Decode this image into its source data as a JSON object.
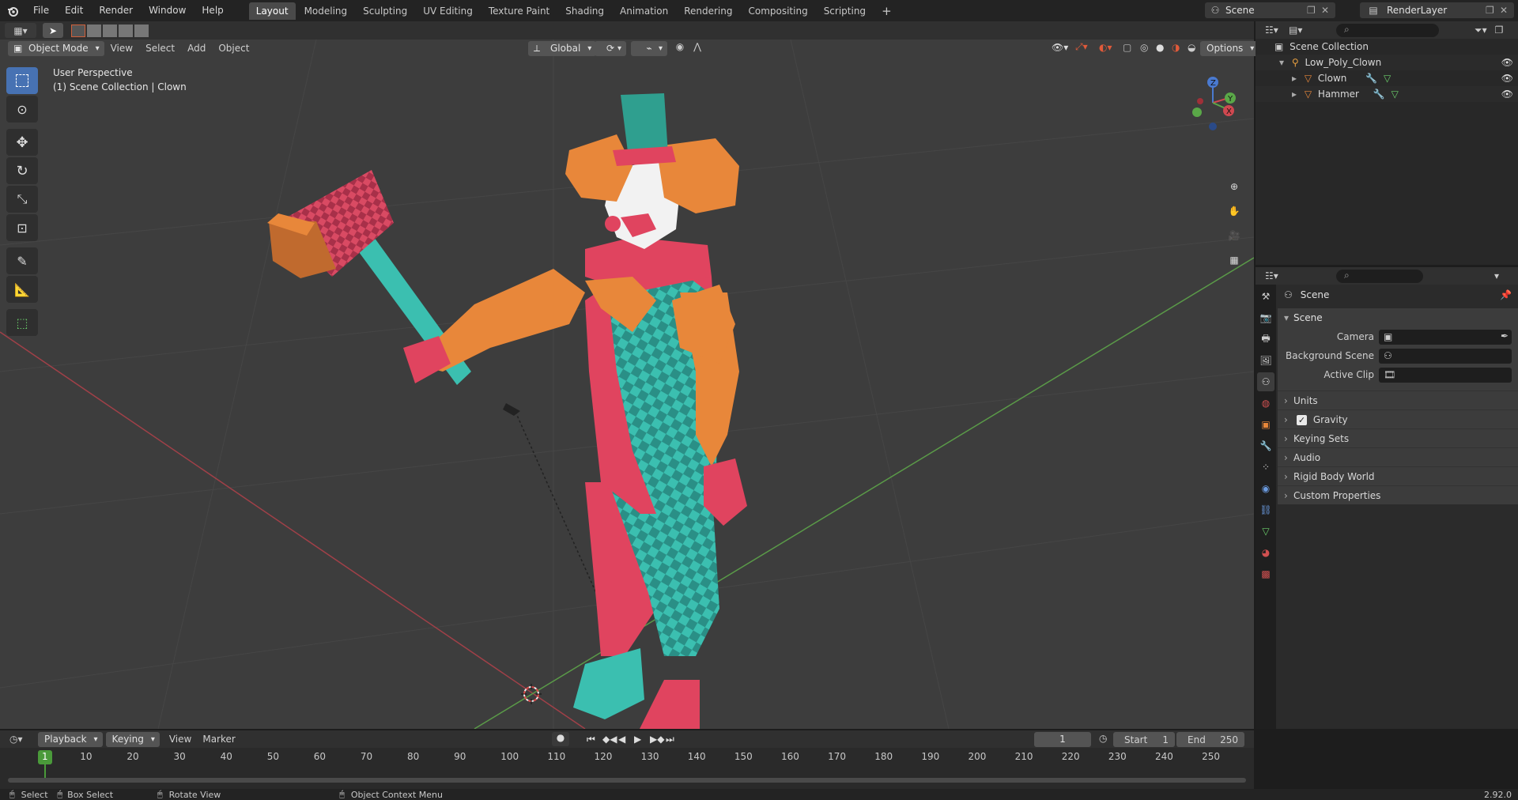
{
  "topbar": {
    "menus": [
      "File",
      "Edit",
      "Render",
      "Window",
      "Help"
    ],
    "workspaces": [
      "Layout",
      "Modeling",
      "Sculpting",
      "UV Editing",
      "Texture Paint",
      "Shading",
      "Animation",
      "Rendering",
      "Compositing",
      "Scripting"
    ],
    "active_workspace": "Layout",
    "add_tab": "+",
    "scene_name": "Scene",
    "view_layer": "RenderLayer"
  },
  "viewport_header": {
    "mode": "Object Mode",
    "menus": [
      "View",
      "Select",
      "Add",
      "Object"
    ],
    "transform_orientation": "Global",
    "options_label": "Options"
  },
  "viewport": {
    "perspective_label": "User Perspective",
    "collection_label": "(1) Scene Collection | Clown"
  },
  "outliner": {
    "root": "Scene Collection",
    "collection": "Low_Poly_Clown",
    "objects": [
      "Clown",
      "Hammer"
    ]
  },
  "properties": {
    "context": "Scene",
    "panel_title": "Scene",
    "fields": [
      {
        "label": "Camera"
      },
      {
        "label": "Background Scene"
      },
      {
        "label": "Active Clip"
      }
    ],
    "subpanels": [
      "Units",
      "Gravity",
      "Keying Sets",
      "Audio",
      "Rigid Body World",
      "Custom Properties"
    ],
    "gravity_checked": true
  },
  "timeline": {
    "menus": [
      "Playback",
      "Keying",
      "View",
      "Marker"
    ],
    "current_frame": "1",
    "start_label": "Start",
    "start": "1",
    "end_label": "End",
    "end": "250",
    "ticks": [
      "1",
      "10",
      "20",
      "30",
      "40",
      "50",
      "60",
      "70",
      "80",
      "90",
      "100",
      "110",
      "120",
      "130",
      "140",
      "150",
      "160",
      "170",
      "180",
      "190",
      "200",
      "210",
      "220",
      "230",
      "240",
      "250"
    ]
  },
  "statusbar": {
    "select": "Select",
    "box_select": "Box Select",
    "rotate_view": "Rotate View",
    "context_menu": "Object Context Menu",
    "version": "2.92.0"
  },
  "colors": {
    "accent": "#4772b3",
    "viewport_bg": "#3d3d3d",
    "clown_orange": "#e8873a",
    "clown_red": "#e0445f",
    "clown_teal": "#3bbfb0"
  }
}
